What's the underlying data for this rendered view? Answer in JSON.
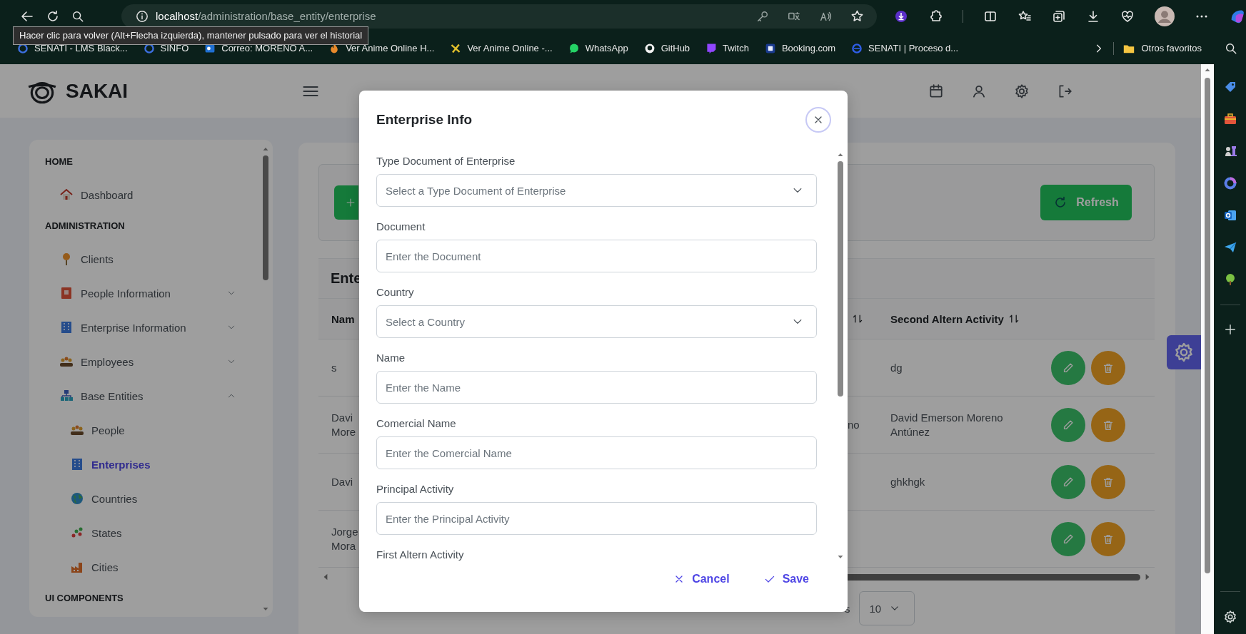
{
  "browser": {
    "address": {
      "host": "localhost",
      "path": "/administration/base_entity/enterprise"
    },
    "tooltip": "Hacer clic para volver (Alt+Flecha izquierda), mantener pulsado para ver el historial",
    "bookmarks": [
      {
        "label": "SENATI - LMS Black..."
      },
      {
        "label": "SINFO"
      },
      {
        "label": "Correo: MORENO A..."
      },
      {
        "label": "Ver Anime Online H..."
      },
      {
        "label": "Ver Anime Online -..."
      },
      {
        "label": "WhatsApp"
      },
      {
        "label": "GitHub"
      },
      {
        "label": "Twitch"
      },
      {
        "label": "Booking.com"
      },
      {
        "label": "SENATI | Proceso d..."
      }
    ],
    "other_favorites": "Otros favoritos"
  },
  "app": {
    "logo": "SAKAI",
    "sidebar": {
      "sections": [
        {
          "title": "HOME",
          "items": [
            {
              "label": "Dashboard",
              "selected": false
            }
          ]
        },
        {
          "title": "ADMINISTRATION",
          "items": [
            {
              "label": "Clients",
              "selected": false
            },
            {
              "label": "People Information",
              "selected": false,
              "expanded": false
            },
            {
              "label": "Enterprise Information",
              "selected": false,
              "expanded": false
            },
            {
              "label": "Employees",
              "selected": false,
              "expanded": false
            },
            {
              "label": "Base Entities",
              "selected": false,
              "expanded": true,
              "children": [
                {
                  "label": "People",
                  "selected": false
                },
                {
                  "label": "Enterprises",
                  "selected": true
                },
                {
                  "label": "Countries",
                  "selected": false
                },
                {
                  "label": "States",
                  "selected": false
                },
                {
                  "label": "Cities",
                  "selected": false
                }
              ]
            }
          ]
        },
        {
          "title": "UI COMPONENTS"
        }
      ]
    },
    "toolbar": {
      "refresh": "Refresh"
    },
    "table": {
      "caption": "Ente",
      "columns": [
        {
          "label": "Nam",
          "sortable": false
        },
        {
          "sortable": true
        },
        {
          "label": "Second Altern Activity",
          "sortable": true
        }
      ],
      "rows": [
        {
          "name": "s",
          "second_altern_activity": "dg"
        },
        {
          "name": "Davi More",
          "column_2": "no",
          "second_altern_activity": "David Emerson Moreno Antúnez"
        },
        {
          "name": "Davi",
          "second_altern_activity": "ghkhgk"
        },
        {
          "name": "Jorge Mora"
        }
      ]
    },
    "paginator": {
      "label_fragment": "s",
      "rows_per_page": "10"
    }
  },
  "modal": {
    "title": "Enterprise Info",
    "fields": [
      {
        "kind": "select",
        "label": "Type Document of Enterprise",
        "placeholder": "Select a Type Document of Enterprise"
      },
      {
        "kind": "input",
        "label": "Document",
        "placeholder": "Enter the Document"
      },
      {
        "kind": "select",
        "label": "Country",
        "placeholder": "Select a Country"
      },
      {
        "kind": "input",
        "label": "Name",
        "placeholder": "Enter the Name"
      },
      {
        "kind": "input",
        "label": "Comercial Name",
        "placeholder": "Enter the Comercial Name"
      },
      {
        "kind": "input",
        "label": "Principal Activity",
        "placeholder": "Enter the Principal Activity"
      },
      {
        "kind": "input",
        "label": "First Altern Activity"
      }
    ],
    "buttons": [
      {
        "kind": "cancel",
        "label": "Cancel"
      },
      {
        "kind": "save",
        "label": "Save"
      }
    ]
  }
}
